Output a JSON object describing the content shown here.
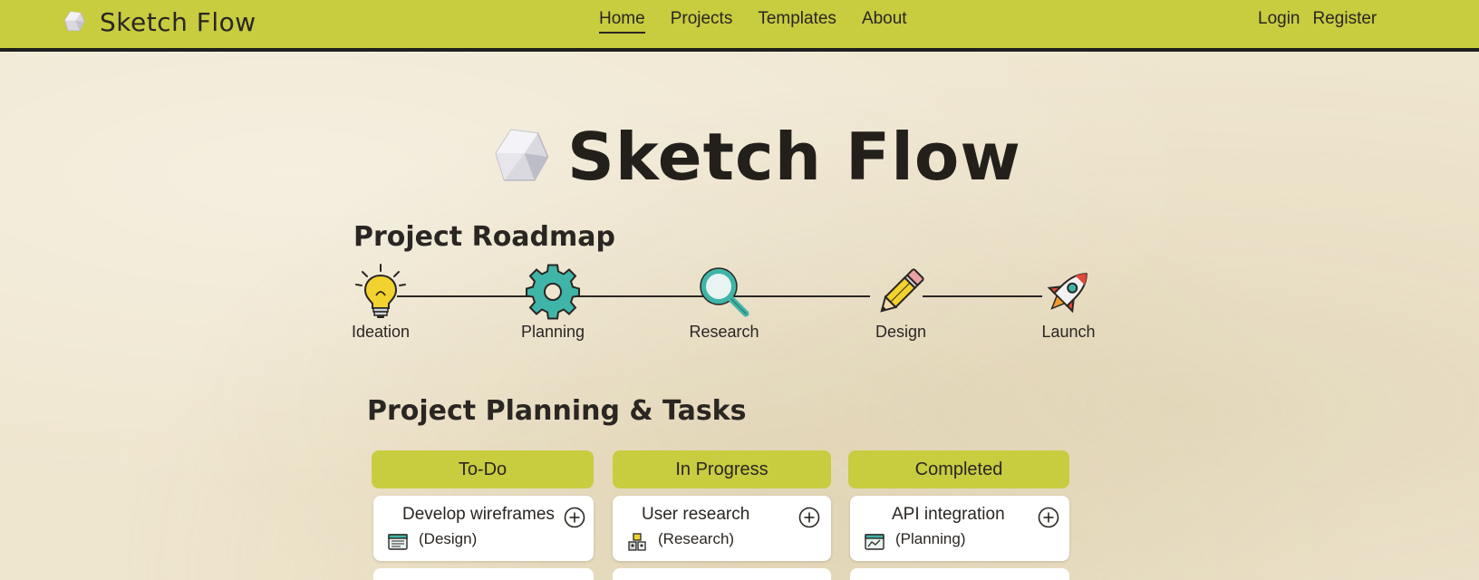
{
  "nav": {
    "brand": "Sketch Flow",
    "links": [
      {
        "label": "Home",
        "active": true
      },
      {
        "label": "Projects"
      },
      {
        "label": "Templates"
      },
      {
        "label": "About"
      }
    ],
    "login_label": "Login",
    "register_label": "Register"
  },
  "hero": {
    "title": "Sketch Flow"
  },
  "roadmap": {
    "title": "Project Roadmap",
    "stages": [
      {
        "label": "Ideation",
        "icon": "lightbulb-icon"
      },
      {
        "label": "Planning",
        "icon": "gear-icon"
      },
      {
        "label": "Research",
        "icon": "magnifier-icon"
      },
      {
        "label": "Design",
        "icon": "pencil-icon"
      },
      {
        "label": "Launch",
        "icon": "rocket-icon"
      }
    ]
  },
  "tasks": {
    "title": "Project Planning & Tasks",
    "columns": [
      {
        "label": "To-Do",
        "cards": [
          {
            "title": "Develop wireframes",
            "tag": "(Design)",
            "icon": "design-board-icon"
          }
        ]
      },
      {
        "label": "In Progress",
        "cards": [
          {
            "title": "User research",
            "tag": "(Research)",
            "icon": "research-icon"
          }
        ]
      },
      {
        "label": "Completed",
        "cards": [
          {
            "title": "API integration",
            "tag": "(Planning)",
            "icon": "planning-board-icon"
          }
        ]
      }
    ]
  },
  "colors": {
    "accent": "#c8cc3f",
    "background": "#efe6cf",
    "text": "#2a2622"
  }
}
